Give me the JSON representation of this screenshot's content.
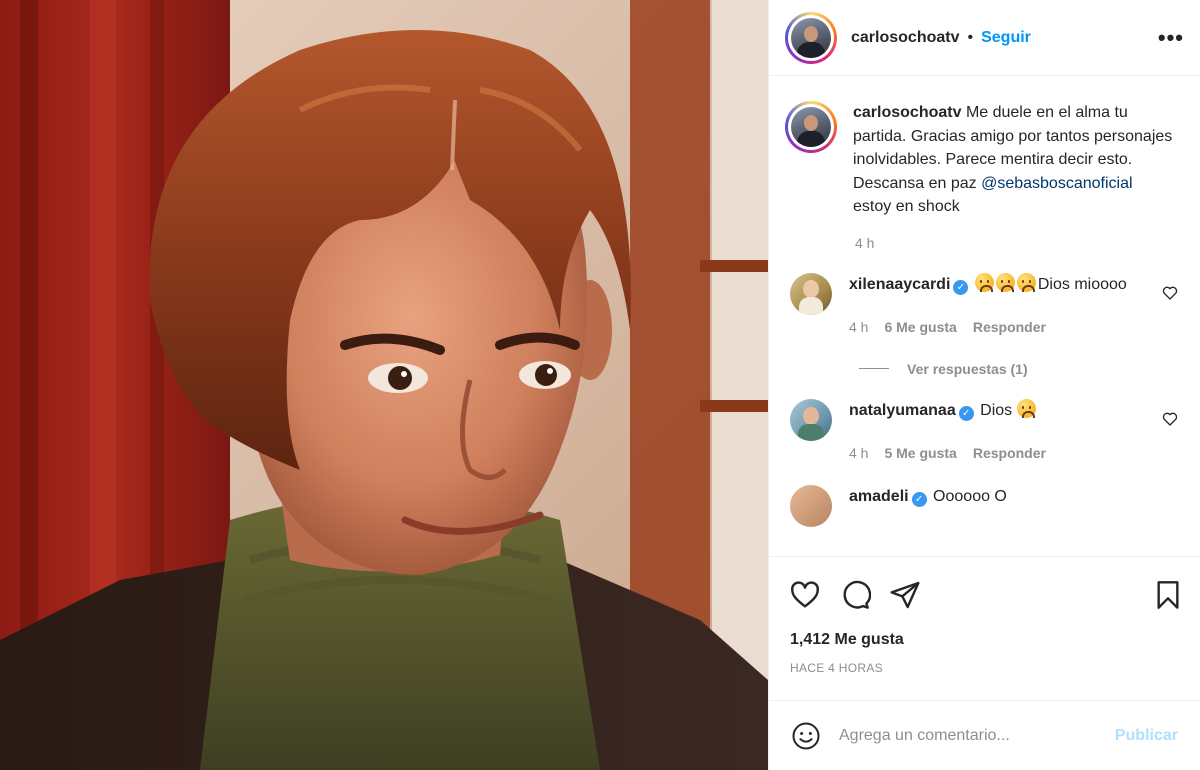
{
  "post": {
    "username": "carlosochoatv",
    "separator": "•",
    "follow_label": "Seguir",
    "more_label": "•••",
    "photo_icon": "portrait-photo"
  },
  "caption": {
    "username": "carlosochoatv",
    "text": "Me duele en el alma tu partida. Gracias amigo por tantos personajes inolvidables. Parece mentira decir esto. Descansa en paz",
    "mention": "@sebasboscanoficial",
    "text_after": "estoy en shock",
    "time": "4 h"
  },
  "comments": [
    {
      "username": "xilenaaycardi",
      "verified": true,
      "emojis": [
        "sad-face",
        "sad-face",
        "sad-face"
      ],
      "text": "Dios mioooo",
      "time": "4 h",
      "likes": "6 Me gusta",
      "reply_label": "Responder",
      "view_replies": "Ver respuestas (1)"
    },
    {
      "username": "natalyumanaa",
      "verified": true,
      "text": "Dios",
      "emojis": [
        "sad-face"
      ],
      "time": "4 h",
      "likes": "5 Me gusta",
      "reply_label": "Responder"
    },
    {
      "username": "amadeli",
      "verified": true,
      "text": "Oooooo O"
    }
  ],
  "actions": {
    "likes": "1,412 Me gusta",
    "time_ago": "HACE 4 HORAS",
    "icons": [
      "heart-icon",
      "comment-icon",
      "share-icon",
      "bookmark-icon"
    ]
  },
  "add_comment": {
    "placeholder": "Agrega un comentario...",
    "post_label": "Publicar"
  },
  "colors": {
    "link_blue": "#0095f6",
    "text": "#262626",
    "secondary": "#8e8e8e",
    "verified": "#3897f0",
    "post_disabled": "#b2dffc"
  }
}
